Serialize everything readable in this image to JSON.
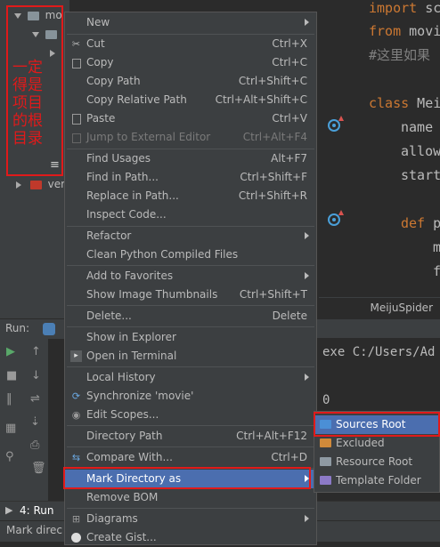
{
  "project_panel": {
    "annotation": "一定得是项目的根目录",
    "row1_label": "mo",
    "row5_label": "ver"
  },
  "editor": {
    "lines": [
      {
        "kw": "import",
        "rest": " sc"
      },
      {
        "kw": "from",
        "rest": " movi"
      },
      {
        "comment": "#这里如果"
      },
      {
        "kw": "class",
        "rest": " Meij"
      },
      {
        "text": "name"
      },
      {
        "text": "allow"
      },
      {
        "text": "start"
      },
      {
        "kw": "def",
        "rest": " p"
      },
      {
        "text": "m"
      },
      {
        "text": "f"
      }
    ],
    "breadcrumb": "MeijuSpider"
  },
  "run_panel": {
    "label": "Run:",
    "console_line1": "exe C:/Users/Ad",
    "console_line2": "0",
    "tab_label": "4: Run",
    "status_text": "Mark direc"
  },
  "context_menu": {
    "items": [
      {
        "label": "New",
        "shortcut": "",
        "submenu": true
      },
      {
        "label": "Cut",
        "shortcut": "Ctrl+X",
        "icon": "cut-icon"
      },
      {
        "label": "Copy",
        "shortcut": "Ctrl+C",
        "icon": "copy-icon"
      },
      {
        "label": "Copy Path",
        "shortcut": "Ctrl+Shift+C"
      },
      {
        "label": "Copy Relative Path",
        "shortcut": "Ctrl+Alt+Shift+C"
      },
      {
        "label": "Paste",
        "shortcut": "Ctrl+V",
        "icon": "paste-icon"
      },
      {
        "label": "Jump to External Editor",
        "shortcut": "Ctrl+Alt+F4",
        "disabled": true
      },
      {
        "label": "Find Usages",
        "shortcut": "Alt+F7"
      },
      {
        "label": "Find in Path...",
        "shortcut": "Ctrl+Shift+F"
      },
      {
        "label": "Replace in Path...",
        "shortcut": "Ctrl+Shift+R"
      },
      {
        "label": "Inspect Code..."
      },
      {
        "label": "Refactor",
        "submenu": true
      },
      {
        "label": "Clean Python Compiled Files"
      },
      {
        "label": "Add to Favorites",
        "submenu": true
      },
      {
        "label": "Show Image Thumbnails",
        "shortcut": "Ctrl+Shift+T"
      },
      {
        "label": "Delete...",
        "shortcut": "Delete"
      },
      {
        "label": "Show in Explorer"
      },
      {
        "label": "Open in Terminal",
        "icon": "terminal-icon"
      },
      {
        "label": "Local History",
        "submenu": true
      },
      {
        "label": "Synchronize 'movie'",
        "icon": "sync-icon"
      },
      {
        "label": "Edit Scopes...",
        "icon": "scope-icon"
      },
      {
        "label": "Directory Path",
        "shortcut": "Ctrl+Alt+F12"
      },
      {
        "label": "Compare With...",
        "shortcut": "Ctrl+D",
        "icon": "compare-icon"
      },
      {
        "label": "Mark Directory as",
        "submenu": true,
        "highlighted": true
      },
      {
        "label": "Remove BOM"
      },
      {
        "label": "Diagrams",
        "submenu": true
      },
      {
        "label": "Create Gist...",
        "icon": "github-icon"
      }
    ]
  },
  "submenu": {
    "items": [
      {
        "label": "Sources Root",
        "color": "#4b8fd6",
        "highlighted": true
      },
      {
        "label": "Excluded",
        "color": "#d08a3a"
      },
      {
        "label": "Resource Root",
        "color": "#8f9aa3"
      },
      {
        "label": "Template Folder",
        "color": "#8c7ac7"
      }
    ]
  }
}
